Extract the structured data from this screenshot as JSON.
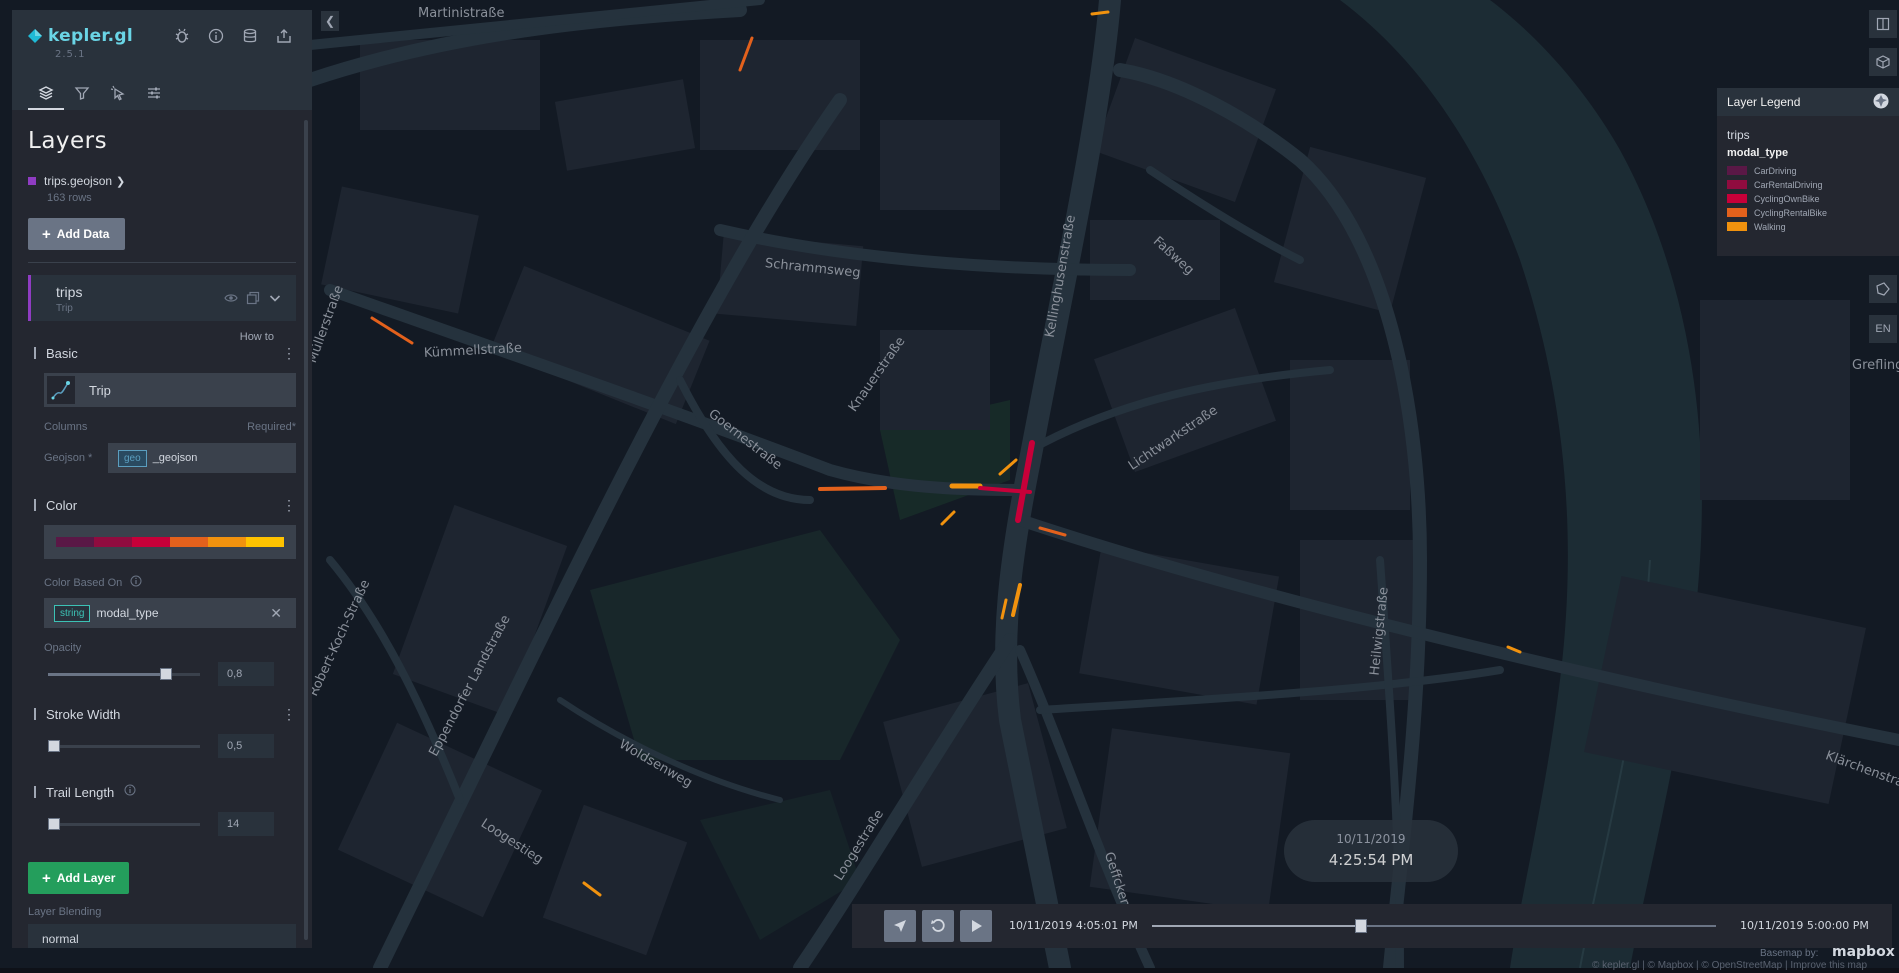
{
  "app": {
    "name": "kepler.gl",
    "version": "2.5.1"
  },
  "sidebar": {
    "title": "Layers",
    "tabs": [
      "layers",
      "filters",
      "interactions",
      "map-settings"
    ],
    "dataset": {
      "name": "trips.geojson",
      "rows": "163 rows",
      "color": "#8f3cc2"
    },
    "add_data_label": "Add Data",
    "layer": {
      "title": "trips",
      "type": "Trip",
      "how_to": "How to",
      "basic": {
        "title": "Basic",
        "type_label": "Trip"
      },
      "columns_label": "Columns",
      "required_label": "Required*",
      "geojson_label": "Geojson *",
      "geojson_pill": "geo",
      "geojson_value": "_geojson",
      "color": {
        "title": "Color",
        "palette": [
          "#5a1846",
          "#900c3f",
          "#c70039",
          "#e3611c",
          "#f1920e",
          "#ffc300"
        ],
        "based_on_label": "Color Based On",
        "field_pill": "string",
        "field_value": "modal_type"
      },
      "opacity": {
        "label": "Opacity",
        "value": "0,8",
        "fraction": 0.8
      },
      "stroke_width": {
        "title": "Stroke Width",
        "value": "0,5",
        "fraction": 0.0
      },
      "trail_length": {
        "title": "Trail Length",
        "value": "14",
        "fraction": 0.0
      }
    },
    "add_layer_label": "Add Layer",
    "blending": {
      "label": "Layer Blending",
      "value": "normal"
    }
  },
  "legend": {
    "title": "Layer Legend",
    "layer": "trips",
    "field": "modal_type",
    "items": [
      {
        "label": "CarDriving",
        "color": "#5a1846"
      },
      {
        "label": "CarRentalDriving",
        "color": "#900c3f"
      },
      {
        "label": "CyclingOwnBike",
        "color": "#c70039"
      },
      {
        "label": "CyclingRentalBike",
        "color": "#e3611c"
      },
      {
        "label": "Walking",
        "color": "#f1920e"
      }
    ]
  },
  "map": {
    "labels": [
      "Martinistraße",
      "Schrammsweg",
      "Faßweg",
      "Kellinghusenstraße",
      "Kümmellstraße",
      "Müllerstraße",
      "Knauerstraße",
      "Goernestraße",
      "Lichtwarkstraße",
      "Robert-Koch-Straße",
      "Eppendorfer Landstraße",
      "Woldsenweg",
      "Heilwigstraße",
      "Loogestieg",
      "Loogestraße",
      "Geffckenstraße",
      "Klärchenstraße",
      "Grefling"
    ],
    "locale": "EN"
  },
  "time_display": {
    "date": "10/11/2019",
    "time": "4:25:54 PM"
  },
  "playback": {
    "start": "10/11/2019 4:05:01 PM",
    "end": "10/11/2019 5:00:00 PM",
    "progress": 0.37
  },
  "attribution": {
    "basemap": "Basemap by:",
    "mapbox": "mapbox",
    "links": "© kepler.gl | © Mapbox | © OpenStreetMap | Improve this map"
  }
}
